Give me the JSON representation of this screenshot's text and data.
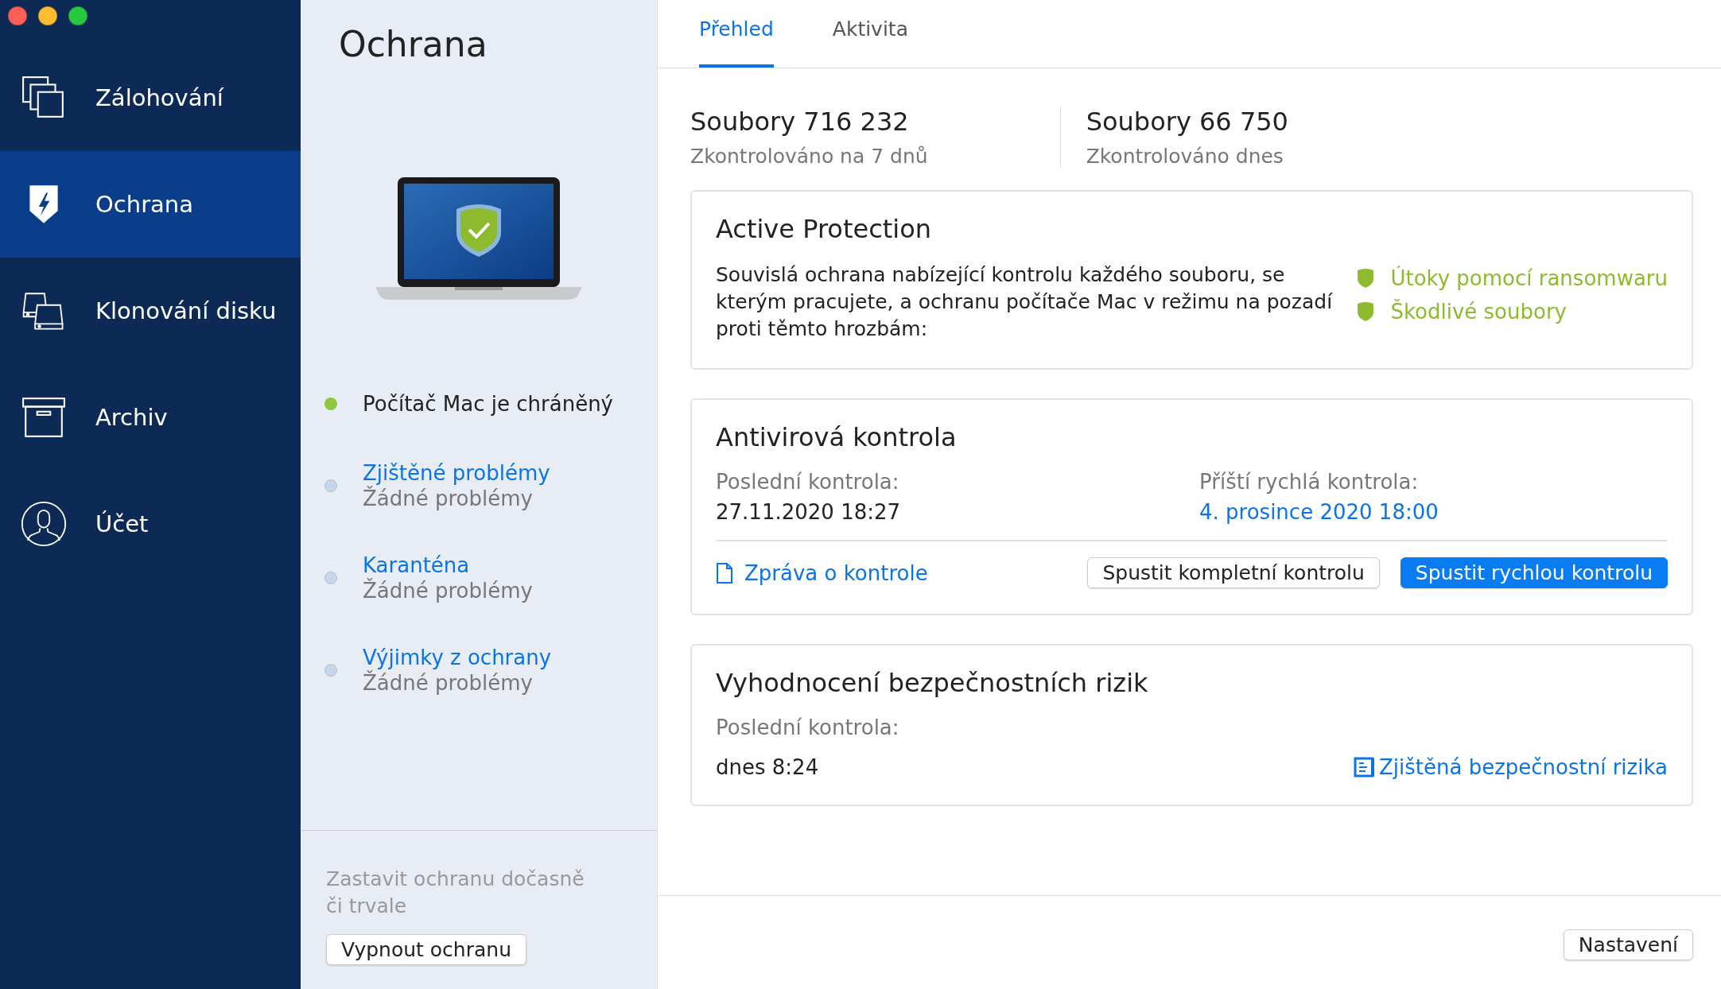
{
  "sidebar": {
    "items": [
      {
        "label": "Zálohování",
        "selected": false
      },
      {
        "label": "Ochrana",
        "selected": true
      },
      {
        "label": "Klonování disku",
        "selected": false
      },
      {
        "label": "Archiv",
        "selected": false
      },
      {
        "label": "Účet",
        "selected": false
      }
    ]
  },
  "panel": {
    "title": "Ochrana",
    "status": [
      {
        "kind": "status",
        "title": "Počítač Mac je chráněný",
        "color": "#8dc63f"
      },
      {
        "kind": "link",
        "title": "Zjištěné problémy",
        "subtitle": "Žádné problémy",
        "color": "#c5d5ea"
      },
      {
        "kind": "link",
        "title": "Karanténa",
        "subtitle": "Žádné problémy",
        "color": "#c5d5ea"
      },
      {
        "kind": "link",
        "title": "Výjimky z ochrany",
        "subtitle": "Žádné problémy",
        "color": "#c5d5ea"
      }
    ],
    "footer_text": "Zastavit ochranu dočasně či trvale",
    "footer_button": "Vypnout ochranu"
  },
  "tabs": [
    {
      "label": "Přehled",
      "selected": true
    },
    {
      "label": "Aktivita",
      "selected": false
    }
  ],
  "stats": [
    {
      "value": "Soubory 716 232",
      "caption": "Zkontrolováno na 7 dnů"
    },
    {
      "value": "Soubory 66 750",
      "caption": "Zkontrolováno dnes"
    }
  ],
  "active_protection": {
    "title": "Active Protection",
    "description": "Souvislá ochrana nabízející kontrolu každého souboru, se kterým pracujete, a ochranu počítače Mac v režimu na pozadí proti těmto hrozbám:",
    "threats": [
      "Útoky pomocí ransomwaru",
      "Škodlivé soubory"
    ]
  },
  "antivirus": {
    "title": "Antivirová kontrola",
    "last_label": "Poslední kontrola:",
    "last_value": "27.11.2020 18:27",
    "next_label": "Příští rychlá kontrola:",
    "next_value": "4. prosince 2020 18:00",
    "report_link": "Zpráva o kontrole",
    "full_scan_button": "Spustit kompletní kontrolu",
    "quick_scan_button": "Spustit rychlou kontrolu"
  },
  "risk": {
    "title": "Vyhodnocení bezpečnostních rizik",
    "last_label": "Poslední kontrola:",
    "last_value": "dnes 8:24",
    "link": "Zjištěná bezpečnostní rizika"
  },
  "settings_button": "Nastavení"
}
